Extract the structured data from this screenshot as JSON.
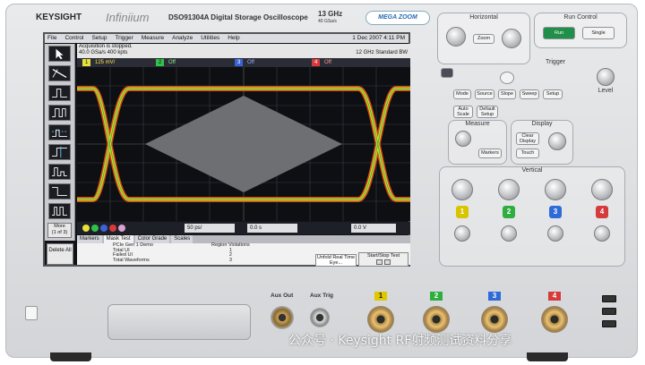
{
  "brand": {
    "maker": "KEYSIGHT",
    "series": "Infiniium",
    "model": "DSO91304A Digital Storage Oscilloscope",
    "bandwidth": "13 GHz",
    "sample_rate": "40 GSa/s",
    "badge": "MEGA ZOOM"
  },
  "menu": {
    "items": [
      "File",
      "Control",
      "Setup",
      "Trigger",
      "Measure",
      "Analyze",
      "Utilities",
      "Help"
    ],
    "datetime": "1 Dec 2007  4:11 PM"
  },
  "status": {
    "line1": "Acquisition is stopped.",
    "line2": "40.0 GSa/s   400 kpts",
    "right": "12 GHz Standard BW"
  },
  "channels": [
    {
      "num": "1",
      "value": "125 mV/",
      "color": "#e7e13a"
    },
    {
      "num": "2",
      "value": "Off",
      "color": "#2ec24a"
    },
    {
      "num": "3",
      "value": "Off",
      "color": "#3a63d8"
    },
    {
      "num": "4",
      "value": "Off",
      "color": "#d83a3a"
    }
  ],
  "toolbar": {
    "more_label": "More",
    "more_sub": "(1 of 3)"
  },
  "controls": {
    "timebase": "50 ps/",
    "delay": "0.0 s",
    "trigger_level": "0.0 V"
  },
  "tabs": [
    "Markers",
    "Mask Test",
    "Color Grade",
    "Scales"
  ],
  "active_tab": "Mask Test",
  "results": {
    "delete_all": "Delete All",
    "rows": [
      "PCIe Gen 1 Demo",
      "Total UI",
      "Failed UI",
      "Total Waveforms",
      "Failed Waveform"
    ],
    "col_header": "Region   Violations",
    "col_values": [
      "1",
      "2",
      "3"
    ],
    "unfold_button": "Unfold Real Time Eye...",
    "startstop_label": "Start/Stop Test"
  },
  "panel": {
    "horizontal": "Horizontal",
    "run_control": "Run Control",
    "run_button": "Run",
    "stop_button": "Stop",
    "single_button": "Single",
    "zoom_button": "Zoom",
    "trigger": "Trigger",
    "measure": "Measure",
    "display": "Display",
    "vertical": "Vertical",
    "mode_buttons": [
      "Mode",
      "Source",
      "Slope",
      "Sweep",
      "Setup"
    ],
    "auto_scale": "Auto Scale",
    "default_setup": "Default Setup",
    "markers_button": "Markers",
    "clear_display": "Clear Display",
    "touch_button": "Touch",
    "level": "Level",
    "push": "Push",
    "ch_numbers": [
      "1",
      "2",
      "3",
      "4"
    ],
    "ch_colors": [
      "#d9c400",
      "#2eae3f",
      "#2f6bd8",
      "#d63b3b"
    ]
  },
  "front": {
    "aux_out": "Aux Out",
    "aux_trig": "Aux Trig",
    "input_nums": [
      "1",
      "2",
      "3",
      "4"
    ]
  },
  "watermark": "公众号 · Keysight RF射频测试资料分享"
}
